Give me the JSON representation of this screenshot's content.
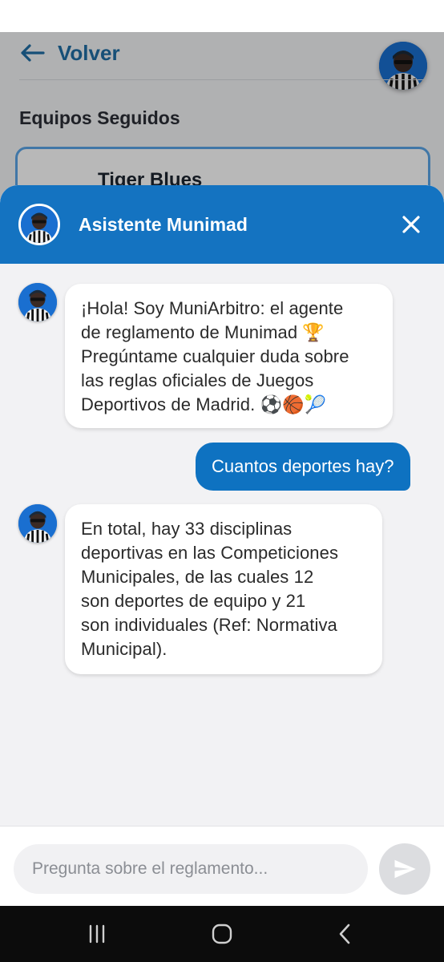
{
  "background_page": {
    "back_label": "Volver",
    "section_title": "Equipos Seguidos",
    "team_name": "Tiger Blues"
  },
  "chat": {
    "title": "Asistente Munimad",
    "messages": [
      {
        "sender": "bot",
        "text": "¡Hola! Soy MuniArbitro: el agente\nde reglamento de Munimad 🏆\nPregúntame cualquier duda sobre\nlas reglas oficiales de Juegos\nDeportivos de Madrid. ⚽🏀🎾"
      },
      {
        "sender": "user",
        "text": "Cuantos deportes hay?"
      },
      {
        "sender": "bot",
        "text": "En total, hay 33 disciplinas\ndeportivas en las Competiciones\nMunicipales, de las cuales 12\nson deportes de equipo y 21\nson individuales (Ref: Normativa\nMunicipal)."
      }
    ],
    "input_placeholder": "Pregunta sobre el reglamento..."
  },
  "icons": {
    "back": "arrow-left-icon",
    "close": "close-icon",
    "send": "send-icon",
    "nav_recents": "recents-icon",
    "nav_home": "home-icon",
    "nav_back": "chevron-left-icon"
  },
  "colors": {
    "primary": "#1473c1",
    "user_bubble": "#0e72c1",
    "back_text": "#1f6ea6",
    "card_border": "#5aa6e8",
    "sheet_bg": "#f2f2f4"
  }
}
